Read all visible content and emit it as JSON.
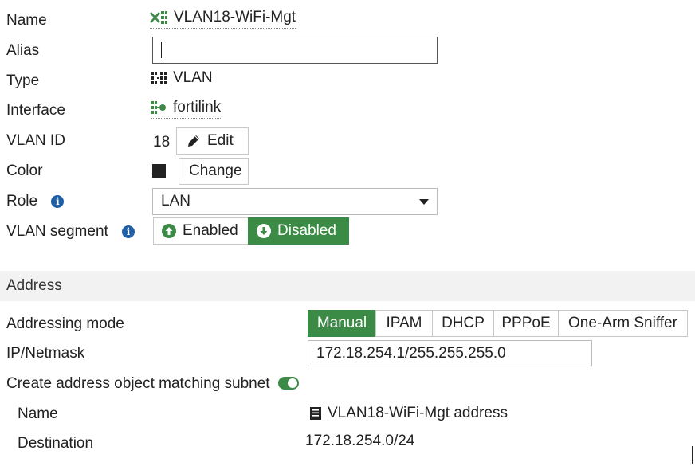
{
  "general": {
    "name_label": "Name",
    "name_value": "VLAN18-WiFi-Mgt",
    "alias_label": "Alias",
    "alias_value": "",
    "type_label": "Type",
    "type_value": "VLAN",
    "interface_label": "Interface",
    "interface_value": "fortilink",
    "vlan_id_label": "VLAN ID",
    "vlan_id_value": "18",
    "edit_label": "Edit",
    "color_label": "Color",
    "color_swatch": "#222222",
    "change_label": "Change",
    "role_label": "Role",
    "role_value": "LAN",
    "vlan_segment_label": "VLAN segment",
    "enabled_label": "Enabled",
    "disabled_label": "Disabled",
    "vlan_segment_selected": "Disabled"
  },
  "address": {
    "section_title": "Address",
    "addressing_mode_label": "Addressing mode",
    "modes": [
      "Manual",
      "IPAM",
      "DHCP",
      "PPPoE",
      "One-Arm Sniffer"
    ],
    "selected_mode": "Manual",
    "ip_netmask_label": "IP/Netmask",
    "ip_netmask_value": "172.18.254.1/255.255.255.0",
    "create_object_label": "Create address object matching subnet",
    "create_object_enabled": true,
    "obj_name_label": "Name",
    "obj_name_value": "VLAN18-WiFi-Mgt address",
    "destination_label": "Destination",
    "destination_value": "172.18.254.0/24"
  },
  "colors": {
    "accent": "#3b8a45",
    "info": "#1f5fa8"
  }
}
